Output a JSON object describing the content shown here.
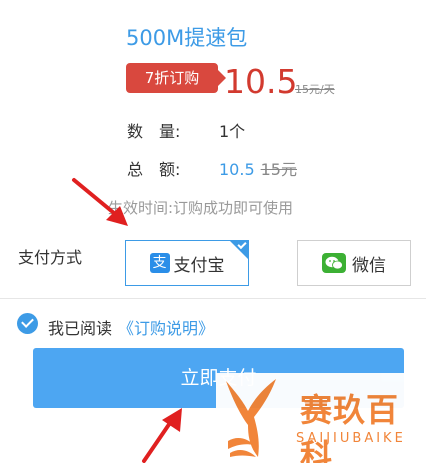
{
  "product": {
    "title": "500M提速包"
  },
  "price": {
    "discount_badge": "7折订购",
    "current": "10.5",
    "original": "15元/天"
  },
  "details": {
    "quantity_label": "数　量:",
    "quantity_value": "1个",
    "total_label": "总　额:",
    "total_new": "10.5",
    "total_old": "15元"
  },
  "effective_note": "生效时间:订购成功即可使用",
  "payment": {
    "label": "支付方式",
    "options": [
      {
        "name": "支付宝",
        "icon": "alipay-icon",
        "selected": true
      },
      {
        "name": "微信",
        "icon": "wechat-icon",
        "selected": false
      }
    ]
  },
  "agreement": {
    "text": "我已阅读",
    "link": "《订购说明》",
    "checked": true
  },
  "pay_button": {
    "label": "立即支付"
  },
  "watermark": {
    "cn": "赛玖百科",
    "en": "SAIJIUBAIKE"
  },
  "colors": {
    "accent": "#3d9be6",
    "badge": "#d9483e",
    "price": "#d23a2f",
    "watermark": "#f18132",
    "arrow": "#e02020"
  }
}
